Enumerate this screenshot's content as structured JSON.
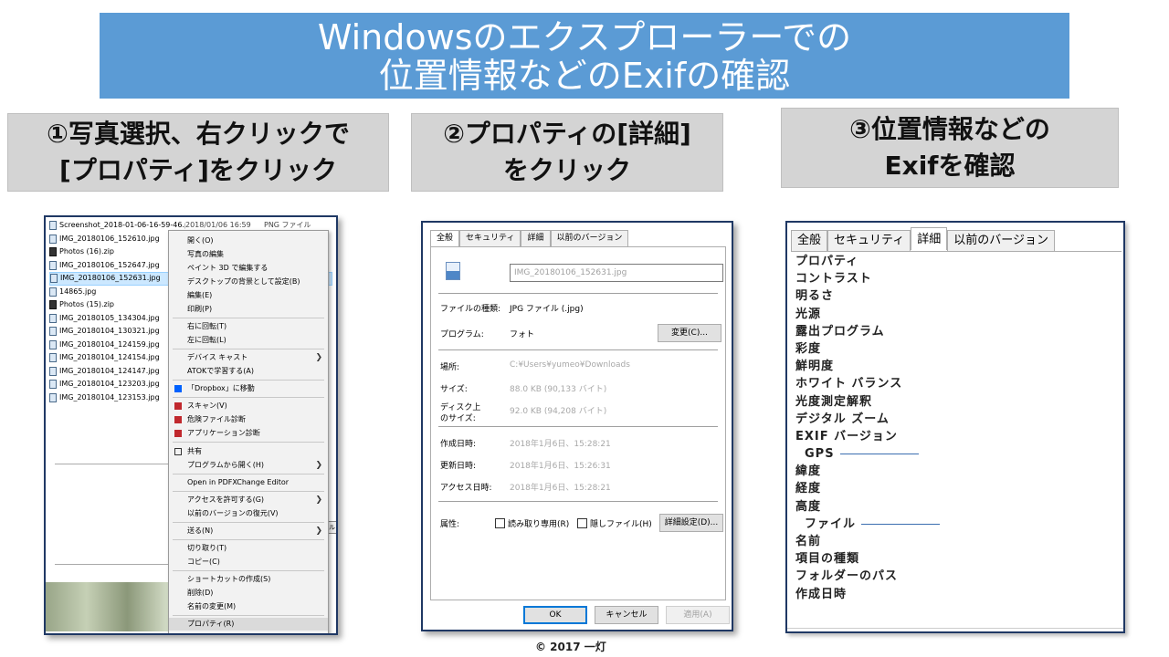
{
  "title": {
    "line1": "Windowsのエクスプローラーでの",
    "line2": "位置情報などのExifの確認"
  },
  "steps": {
    "step1_line1": "①写真選択、右クリックで",
    "step1_line2": "[プロパティ]をクリック",
    "step2_line1": "②プロパティの[詳細]",
    "step2_line2": "をクリック",
    "step3_line1": "③位置情報などの",
    "step3_line2": "Exifを確認"
  },
  "explorer": {
    "files": [
      {
        "name": "Screenshot_2018-01-06-16-59-46.p...",
        "date": "2018/01/06 16:59",
        "type": "PNG ファイル",
        "zip": false
      },
      {
        "name": "IMG_20180106_152610.jpg",
        "date": "",
        "type": "",
        "zip": false
      },
      {
        "name": "Photos (16).zip",
        "date": "",
        "type": "",
        "zip": true
      },
      {
        "name": "IMG_20180106_152647.jpg",
        "date": "",
        "type": "",
        "zip": false
      },
      {
        "name": "IMG_20180106_152631.jpg",
        "date": "",
        "type": "",
        "zip": false
      },
      {
        "name": "14865.jpg",
        "date": "",
        "type": "",
        "zip": false
      },
      {
        "name": "Photos (15).zip",
        "date": "",
        "type": "",
        "zip": true
      },
      {
        "name": "IMG_20180105_134304.jpg",
        "date": "",
        "type": "",
        "zip": false
      },
      {
        "name": "IMG_20180104_130321.jpg",
        "date": "",
        "type": "",
        "zip": false
      },
      {
        "name": "IMG_20180104_124159.jpg",
        "date": "",
        "type": "",
        "zip": false
      },
      {
        "name": "IMG_20180104_124154.jpg",
        "date": "",
        "type": "",
        "zip": false
      },
      {
        "name": "IMG_20180104_124147.jpg",
        "date": "",
        "type": "",
        "zip": false
      },
      {
        "name": "IMG_20180104_123203.jpg",
        "date": "",
        "type": "",
        "zip": false
      },
      {
        "name": "IMG_20180104_123153.jpg",
        "date": "",
        "type": "",
        "zip": false
      }
    ],
    "bg_button": "セル",
    "menu": {
      "open": "開く(O)",
      "edit_photo": "写真の編集",
      "paint3d": "ペイント 3D で編集する",
      "set_bg": "デスクトップの背景として設定(B)",
      "edit": "編集(E)",
      "print": "印刷(P)",
      "rotate_right": "右に回転(T)",
      "rotate_left": "左に回転(L)",
      "cast": "デバイス キャスト",
      "atok": "ATOKで学習する(A)",
      "dropbox": "「Dropbox」に移動",
      "scan": "スキャン(V)",
      "danger_file": "危険ファイル診断",
      "app_diag": "アプリケーション診断",
      "share": "共有",
      "open_with": "プログラムから開く(H)",
      "pdfx": "Open in PDFXChange Editor",
      "access": "アクセスを許可する(G)",
      "restore": "以前のバージョンの復元(V)",
      "send_to": "送る(N)",
      "cut": "切り取り(T)",
      "copy": "コピー(C)",
      "shortcut": "ショートカットの作成(S)",
      "delete": "削除(D)",
      "rename": "名前の変更(M)",
      "properties": "プロパティ(R)"
    }
  },
  "properties": {
    "tabs": [
      "全般",
      "セキュリティ",
      "詳細",
      "以前のバージョン"
    ],
    "filename": "IMG_20180106_152631.jpg",
    "type_label": "ファイルの種類:",
    "type_value": "JPG ファイル (.jpg)",
    "program_label": "プログラム:",
    "program_value": "フォト",
    "change_button": "変更(C)...",
    "location_label": "場所:",
    "location_value": "C:¥Users¥yumeo¥Downloads",
    "size_label": "サイズ:",
    "size_value": "88.0 KB (90,133 バイト)",
    "disk_label1": "ディスク上",
    "disk_label2": "のサイズ:",
    "disk_value": "92.0 KB (94,208 バイト)",
    "created_label": "作成日時:",
    "created_value": "2018年1月6日、15:28:21",
    "modified_label": "更新日時:",
    "modified_value": "2018年1月6日、15:26:31",
    "accessed_label": "アクセス日時:",
    "accessed_value": "2018年1月6日、15:28:21",
    "attr_label": "属性:",
    "readonly_label": "読み取り専用(R)",
    "hidden_label": "隠しファイル(H)",
    "advanced_button": "詳細設定(D)...",
    "ok_button": "OK",
    "cancel_button": "キャンセル",
    "apply_button": "適用(A)"
  },
  "details": {
    "tabs": [
      "全般",
      "セキュリティ",
      "詳細",
      "以前のバージョン"
    ],
    "items": [
      "プロパティ",
      "コントラスト",
      "明るさ",
      "光源",
      "露出プログラム",
      "彩度",
      "鮮明度",
      "ホワイト バランス",
      "光度測定解釈",
      "デジタル ズーム",
      "EXIF バージョン"
    ],
    "gps_section": "GPS",
    "gps_items": [
      "緯度",
      "経度",
      "高度"
    ],
    "file_section": "ファイル",
    "file_items": [
      "名前",
      "項目の種類",
      "フォルダーのパス",
      "作成日時"
    ]
  },
  "copyright": "© 2017 一灯"
}
